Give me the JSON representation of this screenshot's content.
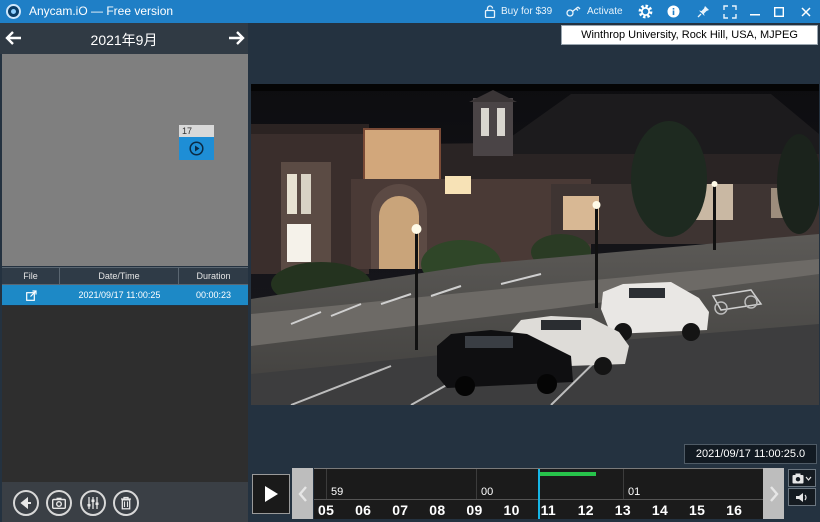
{
  "window": {
    "title": "Anycam.iO — Free version",
    "buy_label": "Buy for $39",
    "activate_label": "Activate"
  },
  "calendar": {
    "month": "2021年9月",
    "recorded_day": "17"
  },
  "recordings": {
    "columns": [
      "File",
      "Date/Time",
      "Duration"
    ],
    "rows": [
      {
        "datetime": "2021/09/17 11:00:25",
        "duration": "00:00:23"
      }
    ]
  },
  "camera": {
    "label": "Winthrop University, Rock Hill, USA, MJPEG",
    "timestamp": "2021/09/17 11:00:25.0"
  },
  "timeline": {
    "minor_labels": [
      "59",
      "00",
      "01"
    ],
    "hour_labels": [
      "05",
      "06",
      "07",
      "08",
      "09",
      "10",
      "11",
      "12",
      "13",
      "14",
      "15",
      "16"
    ]
  },
  "icons": {
    "logo": "anycam-logo-icon",
    "lock": "lock-icon",
    "activate": "key-icon",
    "settings": "gear-icon",
    "info": "info-icon",
    "pin": "pin-icon",
    "fullscreen": "fullscreen-icon",
    "minimize": "minimize-icon",
    "maximize": "maximize-icon",
    "close": "close-icon",
    "prev": "arrow-left-icon",
    "next": "arrow-right-icon",
    "play": "play-icon",
    "snapshot": "camera-icon",
    "volume": "speaker-icon",
    "back": "back-icon",
    "adjust": "sliders-icon",
    "delete": "trash-icon",
    "export": "export-icon"
  },
  "colors": {
    "titlebar": "#1f7fc6",
    "selected_row": "#1d89c6",
    "playhead": "#16b6e6",
    "recording_segment": "#27c34b"
  }
}
